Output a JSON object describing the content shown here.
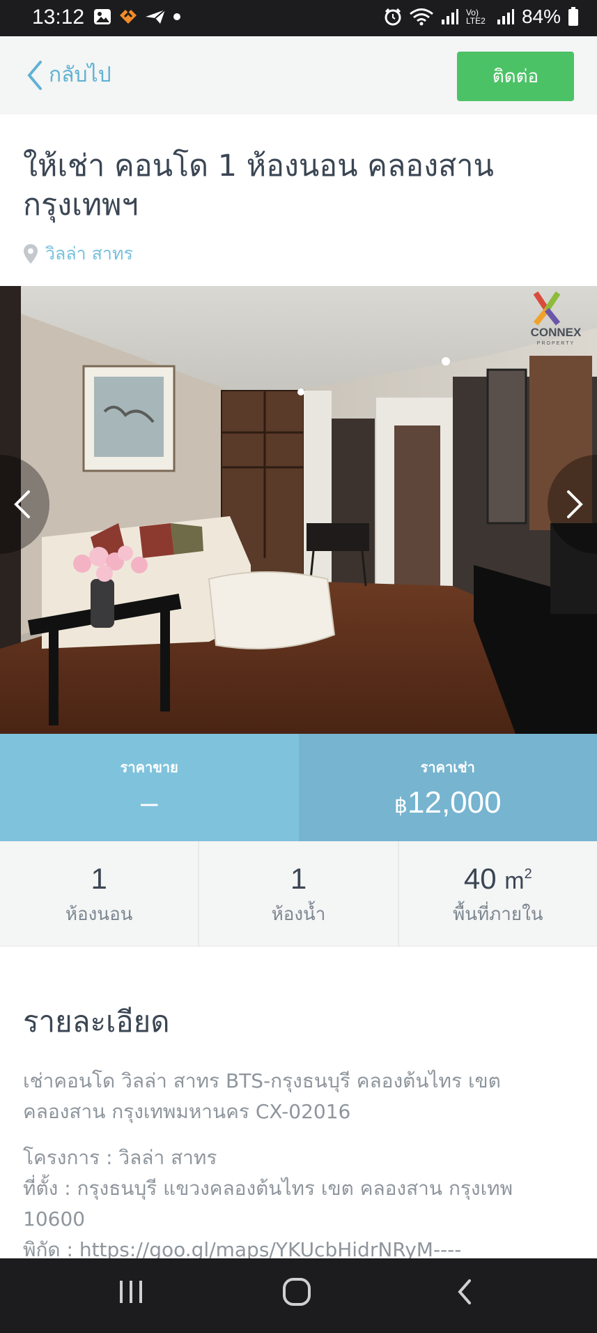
{
  "status_bar": {
    "time": "13:12",
    "battery": "84%",
    "network_label": "Vo) LTE2",
    "icons": [
      "image-icon",
      "app-icon",
      "send-icon",
      "dot-icon",
      "alarm-icon",
      "wifi-icon",
      "signal-icon",
      "battery-icon"
    ]
  },
  "header": {
    "back_label": "กลับไป",
    "contact_label": "ติดต่อ"
  },
  "listing": {
    "title": "ให้เช่า คอนโด 1 ห้องนอน คลองสาน กรุงเทพฯ",
    "location": "วิลล่า สาทร"
  },
  "photo": {
    "watermark": "CONNEX PROPERTY"
  },
  "price": {
    "sale_label": "ราคาขาย",
    "sale_value": "–",
    "rent_label": "ราคาเช่า",
    "currency": "฿",
    "rent_value": "12,000"
  },
  "stats": {
    "bedrooms_value": "1",
    "bedrooms_label": "ห้องนอน",
    "bathrooms_value": "1",
    "bathrooms_label": "ห้องน้ำ",
    "area_value": "40",
    "area_unit": "m",
    "area_sup": "2",
    "area_label": "พื้นที่ภายใน"
  },
  "details": {
    "heading": "รายละเอียด",
    "paragraph1": "เช่าคอนโด วิลล่า สาทร BTS-กรุงธนบุรี คลองต้นไทร เขต คลองสาน กรุงเทพมหานคร CX-02016",
    "project_line": "โครงการ : วิลล่า สาทร",
    "address_line": "ที่ตั้ง : กรุงธนบุรี แขวงคลองต้นไทร เขต คลองสาน กรุงเทพ 10600",
    "coord_line": "พิกัด : https://goo.gl/maps/YKUcbHidrNRyM----"
  },
  "colors": {
    "accent_blue": "#5fb2d4",
    "contact_green": "#4cc267",
    "sale_bg": "#7fc2dc",
    "rent_bg": "#76b4d0"
  }
}
